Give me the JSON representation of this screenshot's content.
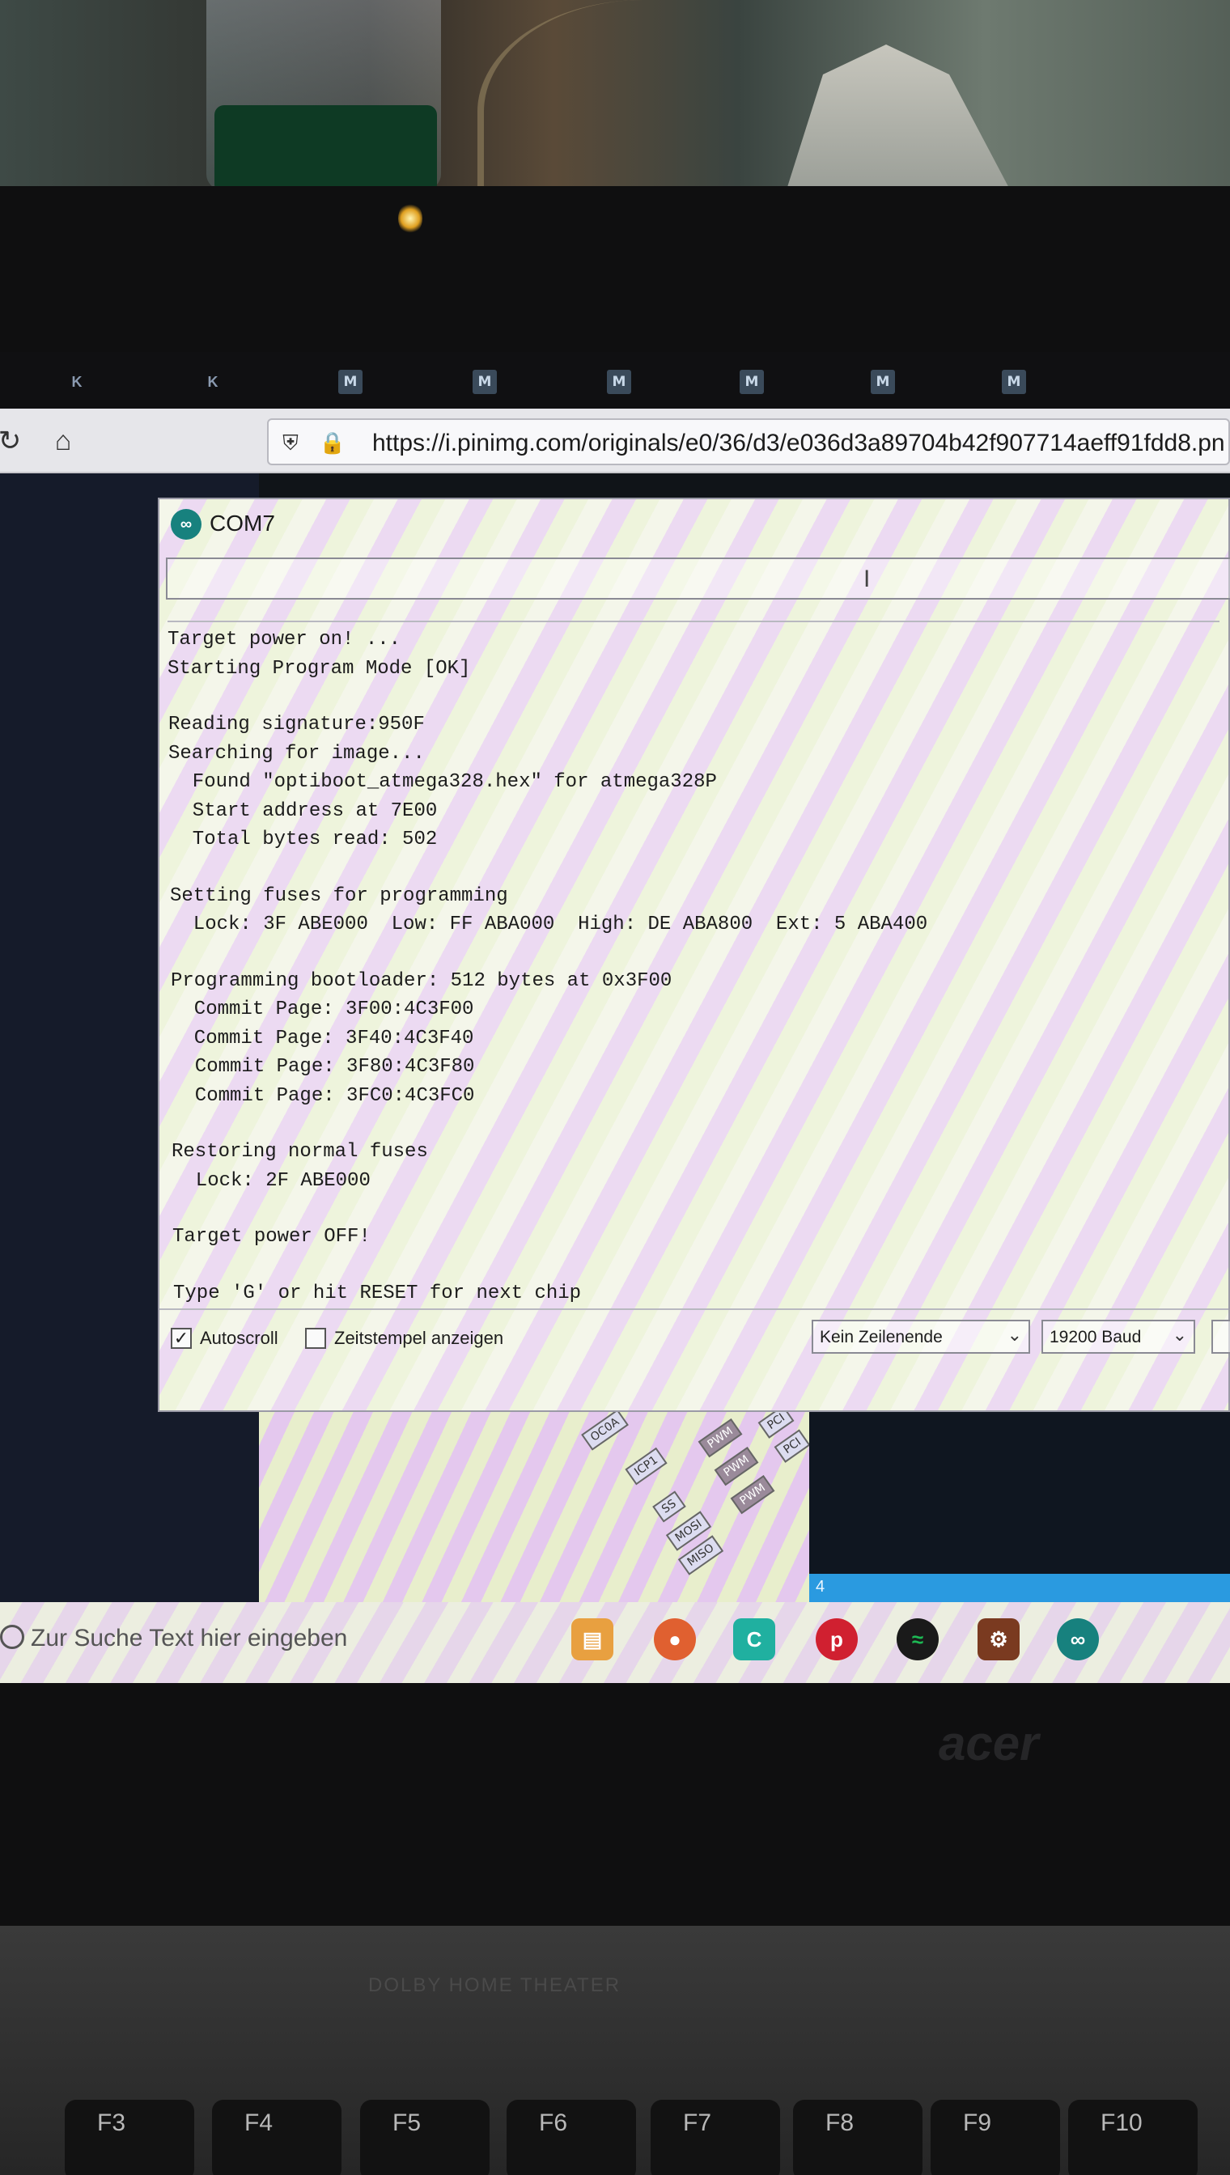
{
  "browser": {
    "tab_letters": [
      "K",
      "K",
      "M",
      "M",
      "M",
      "M",
      "M",
      "M"
    ],
    "url": "https://i.pinimg.com/originals/e0/36/d3/e036d3a89704b42f907714aeff91fdd8.pn"
  },
  "serial_monitor": {
    "title": "COM7",
    "output_lines": [
      "Target power on! ...",
      "Starting Program Mode [OK]",
      "",
      "Reading signature:950F",
      "Searching for image...",
      "  Found \"optiboot_atmega328.hex\" for atmega328P",
      "  Start address at 7E00",
      "  Total bytes read: 502",
      "",
      "Setting fuses for programming",
      "  Lock: 3F ABE000  Low: FF ABA000  High: DE ABA800  Ext: 5 ABA400",
      "",
      "Programming bootloader: 512 bytes at 0x3F00",
      "  Commit Page: 3F00:4C3F00",
      "  Commit Page: 3F40:4C3F40",
      "  Commit Page: 3F80:4C3F80",
      "  Commit Page: 3FC0:4C3FC0",
      "",
      "Restoring normal fuses",
      "  Lock: 2F ABE000",
      "",
      "Target power OFF!",
      "",
      "Type 'G' or hit RESET for next chip"
    ],
    "autoscroll_label": "Autoscroll",
    "autoscroll_checked": true,
    "timestamp_label": "Zeitstempel anzeigen",
    "timestamp_checked": false,
    "line_ending": "Kein Zeilenende",
    "baud_rate": "19200 Baud"
  },
  "pinout_labels": [
    "OC0A",
    "ICP1",
    "SS",
    "MOSI",
    "MISO",
    "PWM",
    "PWM",
    "PWM",
    "PCI",
    "PCI"
  ],
  "desktop_window_number": "4",
  "taskbar": {
    "search_placeholder": "Zur Suche Text hier eingeben"
  },
  "laptop": {
    "brand": "acer",
    "badge": "DOLBY  HOME THEATER",
    "function_keys": [
      "F3",
      "F4",
      "F5",
      "F6",
      "F7",
      "F8",
      "F9",
      "F10"
    ]
  }
}
